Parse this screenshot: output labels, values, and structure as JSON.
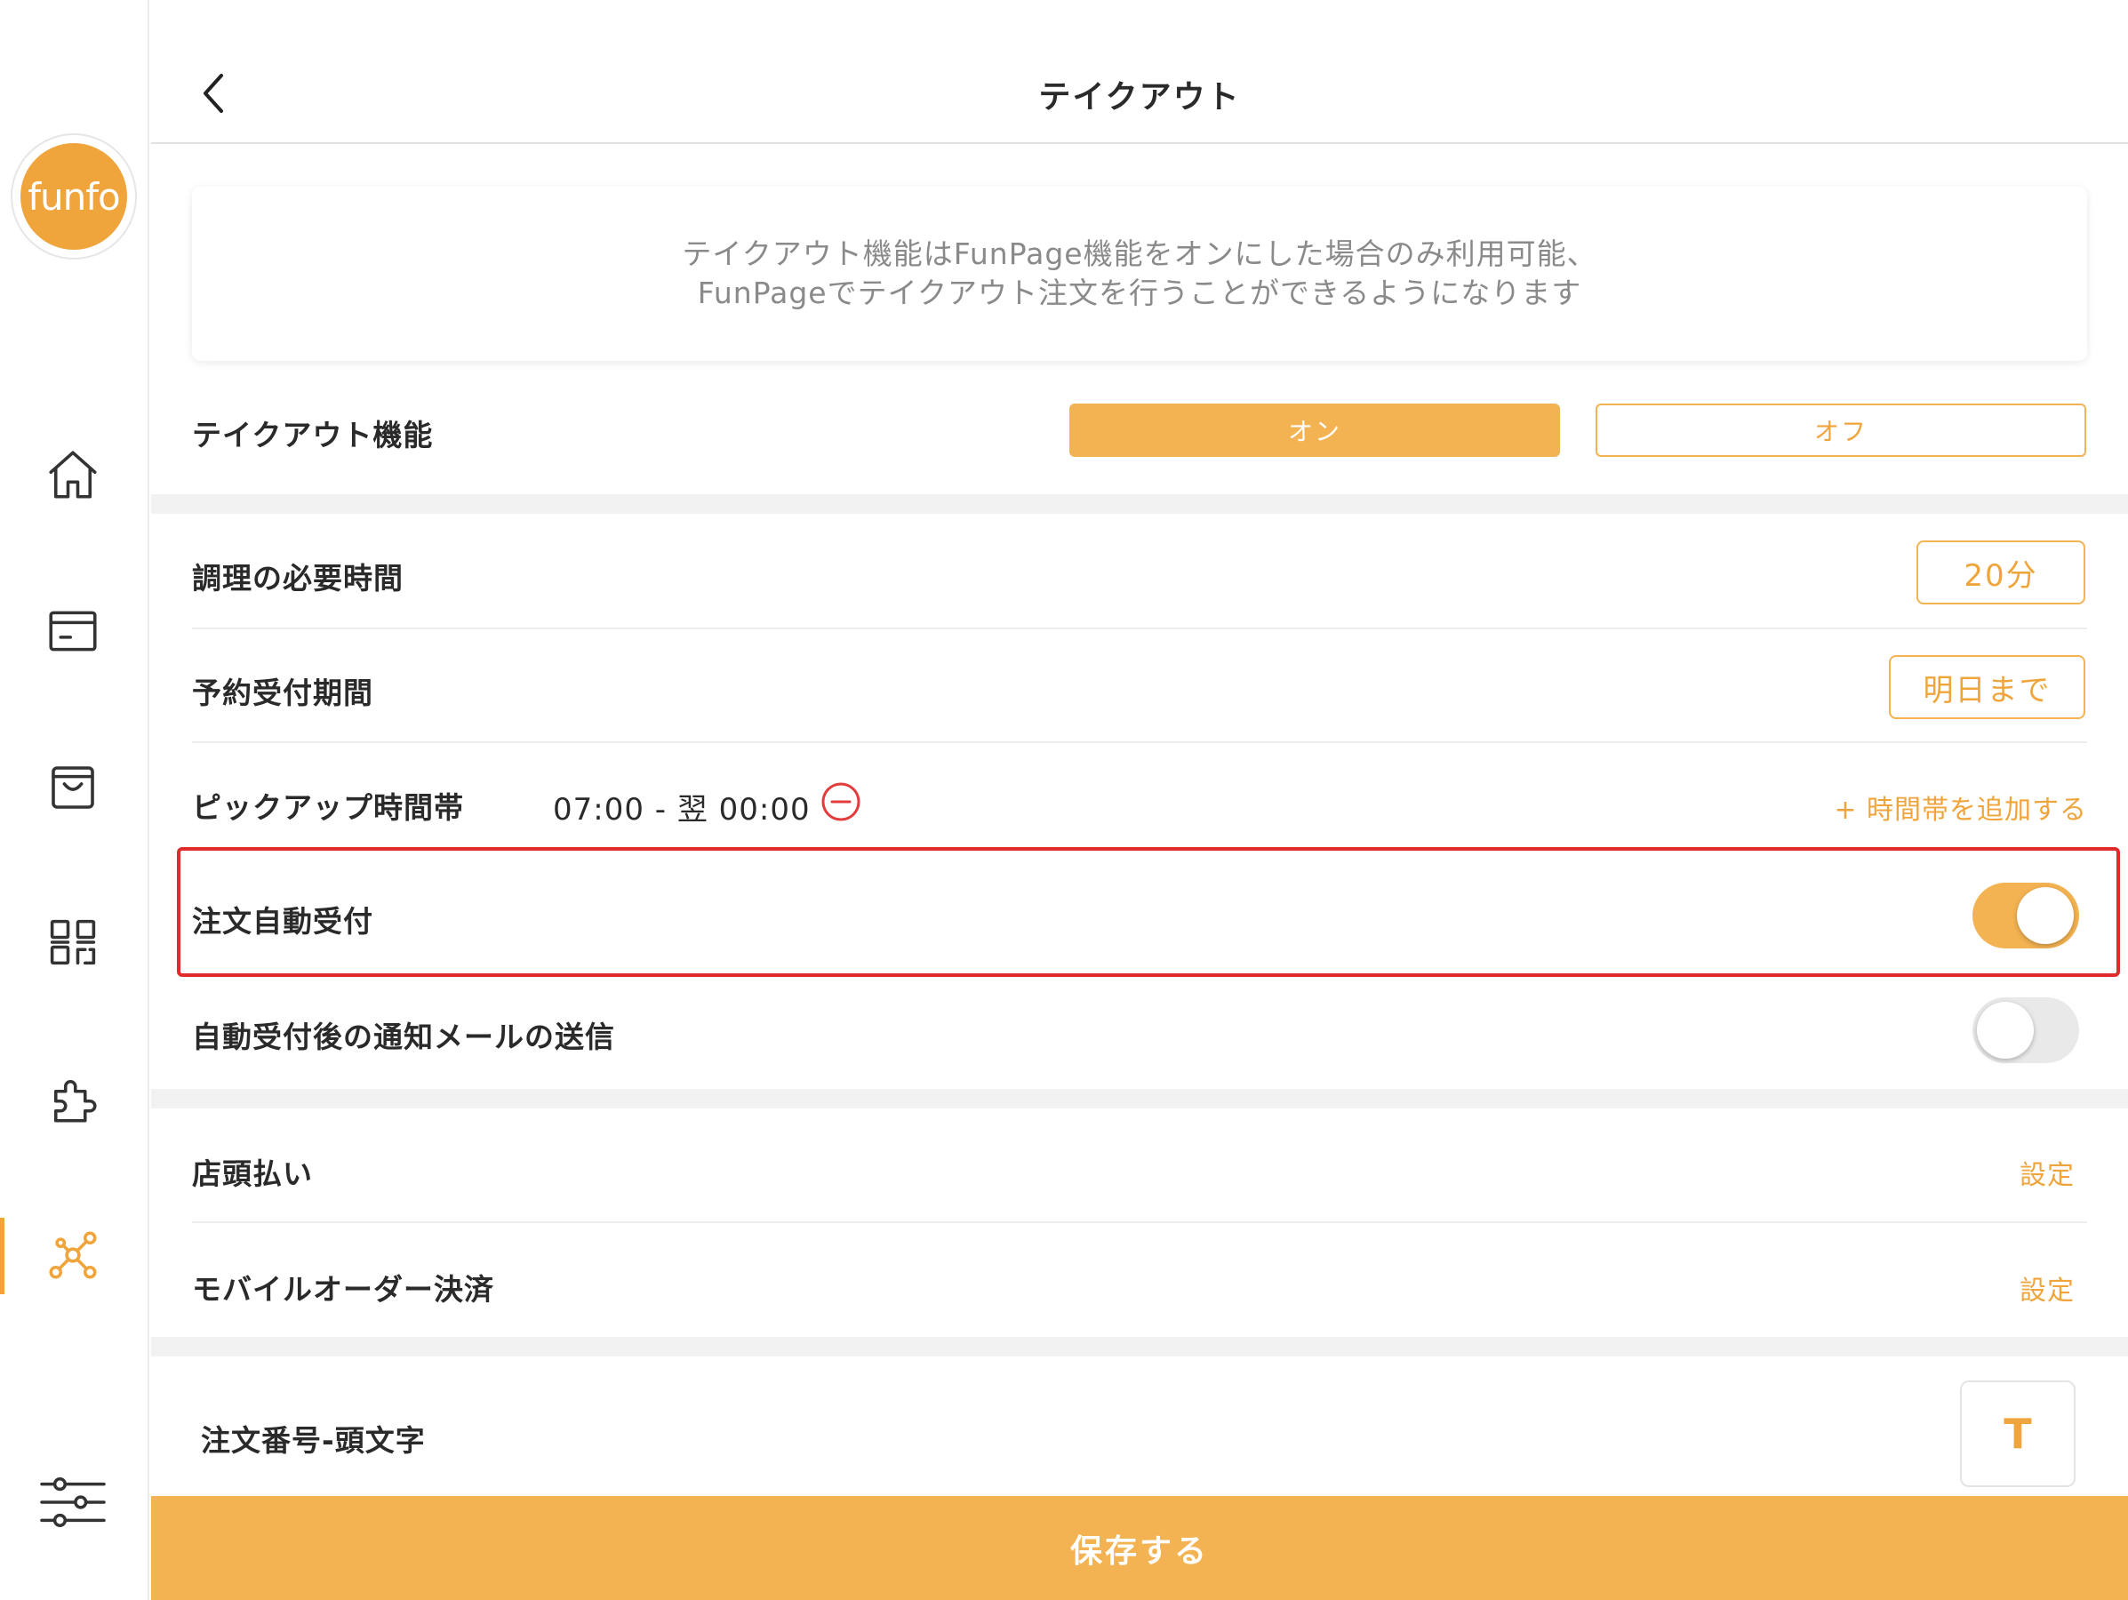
{
  "app": {
    "logo_text": "funfo",
    "brand_color": "#f0a43c",
    "accent_light": "#f4b352",
    "highlight_color": "#e02b2b"
  },
  "sidebar": {
    "items": [
      {
        "icon": "home-icon",
        "active": false
      },
      {
        "icon": "card-icon",
        "active": false
      },
      {
        "icon": "shopping-bag-icon",
        "active": false
      },
      {
        "icon": "qr-code-icon",
        "active": false
      },
      {
        "icon": "puzzle-icon",
        "active": false
      },
      {
        "icon": "network-icon",
        "active": true
      }
    ],
    "settings_icon": "sliders-icon"
  },
  "header": {
    "title": "テイクアウト",
    "back_icon": "chevron-left-icon"
  },
  "info": {
    "line1": "テイクアウト機能はFunPage機能をオンにした場合のみ利用可能、",
    "line2": "FunPageでテイクアウト注文を行うことができるようになります"
  },
  "takeout_feature": {
    "label": "テイクアウト機能",
    "on_label": "オン",
    "off_label": "オフ",
    "selected": "オン"
  },
  "cooking_time": {
    "label": "調理の必要時間",
    "value": "20分"
  },
  "reservation_period": {
    "label": "予約受付期間",
    "value": "明日まで"
  },
  "pickup": {
    "label": "ピックアップ時間帯",
    "range": "07:00 - 翌 00:00",
    "add_label": "+ 時間帯を追加する"
  },
  "auto_accept": {
    "label": "注文自動受付",
    "enabled": true
  },
  "auto_mail": {
    "label": "自動受付後の通知メールの送信",
    "enabled": false
  },
  "pay_at_store": {
    "label": "店頭払い",
    "action": "設定"
  },
  "mobile_payment": {
    "label": "モバイルオーダー決済",
    "action": "設定"
  },
  "order_prefix": {
    "label": "注文番号-頭文字",
    "value": "T"
  },
  "save": {
    "label": "保存する"
  }
}
